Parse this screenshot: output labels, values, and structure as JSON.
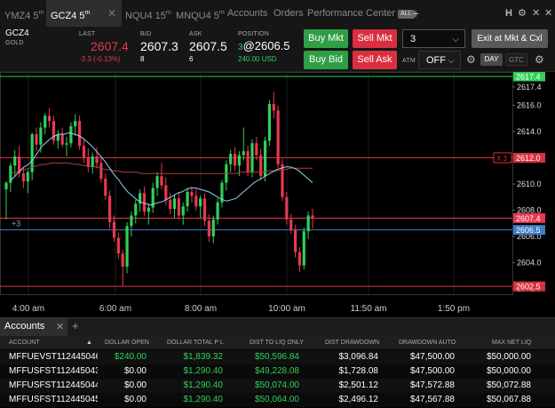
{
  "tabs": [
    {
      "symbol": "YMZ4",
      "interval": "5",
      "unit": "m"
    },
    {
      "symbol": "GCZ4",
      "interval": "5",
      "unit": "m"
    },
    {
      "symbol": "NQU4",
      "interval": "15",
      "unit": "m"
    },
    {
      "symbol": "MNQU4",
      "interval": "5",
      "unit": "m"
    }
  ],
  "nav": {
    "accounts": "Accounts",
    "orders": "Orders",
    "performance": "Performance Center",
    "all_badge": "ALL",
    "add": "+"
  },
  "window_icons": {
    "h": "H",
    "gear": "⚙",
    "close": "✕"
  },
  "instrument": {
    "symbol": "GCZ4",
    "name": "GOLD"
  },
  "quote": {
    "last_label": "LAST",
    "last": "2607.4",
    "change": "-3.3 (-0.13%)",
    "bid_label": "BID",
    "bid": "2607.3",
    "bid_size": "8",
    "ask_label": "ASK",
    "ask": "2607.5",
    "ask_size": "6",
    "position_label": "POSITION",
    "position_qty": "3",
    "position_price": "@2606.5",
    "pnl": "240.00 USD"
  },
  "buttons": {
    "buy_mkt": "Buy Mkt",
    "sell_mkt": "Sell Mkt",
    "buy_bid": "Buy Bid",
    "sell_ask": "Sell Ask",
    "exit": "Exit at Mkt & Cxl"
  },
  "quantity": "3",
  "atm_label": "ATM",
  "atm_value": "OFF",
  "tif": {
    "day": "DAY",
    "gtc": "GTC"
  },
  "colors": {
    "up": "#2fd158",
    "down": "#e8384f",
    "accent": "#2e9f44",
    "sell": "#d9303f",
    "sma": "#8fd3ee",
    "ema": "#b0403f"
  },
  "chart_data": {
    "type": "candlestick",
    "title": "",
    "xlabel": "",
    "ylabel": "",
    "ylim": [
      2601.6,
      2618.4
    ],
    "y_ticks": [
      "2617.4",
      "2616.0",
      "2614.0",
      "2612.0",
      "2610.0",
      "2608.0",
      "2606.0",
      "2604.0",
      "2602.0"
    ],
    "x_ticks": [
      "4:00 am",
      "6:00 am",
      "8:00 am",
      "10:00 am",
      "11:50 am",
      "1:50 pm"
    ],
    "price_lines": [
      {
        "label": "2617.4",
        "value": 2618.2,
        "color": "#2fd158"
      },
      {
        "label": "2612.0",
        "value": 2612.0,
        "color": "#d9303f",
        "tag": "X 3"
      },
      {
        "label": "2607.4",
        "value": 2607.4,
        "color": "#e8384f"
      },
      {
        "label": "2606.5",
        "value": 2606.5,
        "color": "#3b7fc4",
        "tag": "+3"
      },
      {
        "label": "2602.5",
        "value": 2602.2,
        "color": "#d9303f"
      }
    ],
    "candles": [
      [
        2609.6,
        2610.2,
        2607.3,
        2610.1
      ],
      [
        2610.1,
        2611.6,
        2609.4,
        2611.4
      ],
      [
        2611.4,
        2612.6,
        2610.6,
        2612.1
      ],
      [
        2612.1,
        2612.9,
        2610.5,
        2610.8
      ],
      [
        2610.8,
        2611.3,
        2609.7,
        2610.2
      ],
      [
        2610.2,
        2611.1,
        2609.3,
        2610.9
      ],
      [
        2610.9,
        2613.9,
        2610.3,
        2613.8
      ],
      [
        2613.8,
        2614.3,
        2612.5,
        2613.0
      ],
      [
        2613.0,
        2614.7,
        2612.4,
        2614.3
      ],
      [
        2614.3,
        2615.4,
        2613.8,
        2615.2
      ],
      [
        2615.2,
        2615.8,
        2614.3,
        2614.8
      ],
      [
        2614.8,
        2615.2,
        2613.0,
        2613.3
      ],
      [
        2613.3,
        2614.1,
        2612.7,
        2613.8
      ],
      [
        2613.8,
        2614.3,
        2612.8,
        2613.0
      ],
      [
        2613.0,
        2613.6,
        2612.1,
        2613.1
      ],
      [
        2613.1,
        2614.7,
        2612.8,
        2614.4
      ],
      [
        2614.4,
        2615.3,
        2613.7,
        2614.8
      ],
      [
        2614.8,
        2615.2,
        2612.6,
        2612.9
      ],
      [
        2612.9,
        2613.4,
        2611.6,
        2612.0
      ],
      [
        2612.0,
        2612.7,
        2610.9,
        2611.3
      ],
      [
        2611.3,
        2612.4,
        2610.8,
        2612.1
      ],
      [
        2612.1,
        2612.8,
        2611.2,
        2611.6
      ],
      [
        2611.6,
        2612.0,
        2610.1,
        2610.4
      ],
      [
        2610.4,
        2610.8,
        2608.8,
        2609.1
      ],
      [
        2609.1,
        2609.5,
        2606.6,
        2607.1
      ],
      [
        2607.1,
        2607.6,
        2605.6,
        2605.9
      ],
      [
        2605.9,
        2606.3,
        2604.3,
        2604.7
      ],
      [
        2604.7,
        2605.0,
        2602.2,
        2603.7
      ],
      [
        2603.7,
        2607.1,
        2603.2,
        2606.8
      ],
      [
        2606.8,
        2607.9,
        2606.0,
        2607.6
      ],
      [
        2607.6,
        2608.8,
        2607.0,
        2608.5
      ],
      [
        2608.5,
        2609.6,
        2607.9,
        2609.3
      ],
      [
        2609.3,
        2609.8,
        2607.6,
        2607.9
      ],
      [
        2607.9,
        2608.5,
        2606.9,
        2608.2
      ],
      [
        2608.2,
        2610.1,
        2607.8,
        2609.7
      ],
      [
        2609.7,
        2610.9,
        2609.1,
        2610.6
      ],
      [
        2610.6,
        2611.6,
        2609.6,
        2609.9
      ],
      [
        2609.9,
        2610.5,
        2608.4,
        2608.8
      ],
      [
        2608.8,
        2609.3,
        2607.7,
        2608.1
      ],
      [
        2608.1,
        2609.2,
        2607.4,
        2608.9
      ],
      [
        2608.9,
        2609.4,
        2607.3,
        2607.6
      ],
      [
        2607.6,
        2608.6,
        2606.9,
        2608.3
      ],
      [
        2608.3,
        2609.7,
        2607.9,
        2609.4
      ],
      [
        2609.4,
        2609.8,
        2608.6,
        2609.1
      ],
      [
        2609.1,
        2609.6,
        2608.0,
        2608.3
      ],
      [
        2608.3,
        2609.1,
        2607.4,
        2608.9
      ],
      [
        2608.9,
        2609.3,
        2606.8,
        2607.2
      ],
      [
        2607.2,
        2607.7,
        2605.6,
        2606.0
      ],
      [
        2606.0,
        2607.6,
        2605.5,
        2607.3
      ],
      [
        2607.3,
        2608.9,
        2606.9,
        2608.6
      ],
      [
        2608.6,
        2610.3,
        2608.2,
        2610.1
      ],
      [
        2610.1,
        2611.8,
        2609.5,
        2611.5
      ],
      [
        2611.5,
        2612.6,
        2610.9,
        2612.3
      ],
      [
        2612.3,
        2612.8,
        2611.0,
        2611.4
      ],
      [
        2611.4,
        2612.5,
        2610.6,
        2612.2
      ],
      [
        2612.2,
        2614.3,
        2611.8,
        2612.5
      ],
      [
        2612.5,
        2612.9,
        2610.6,
        2610.9
      ],
      [
        2610.9,
        2613.4,
        2610.5,
        2613.1
      ],
      [
        2613.1,
        2613.6,
        2611.8,
        2612.2
      ],
      [
        2612.2,
        2612.7,
        2610.3,
        2610.6
      ],
      [
        2610.6,
        2613.6,
        2610.2,
        2613.3
      ],
      [
        2613.3,
        2616.4,
        2612.9,
        2616.1
      ],
      [
        2616.1,
        2617.0,
        2615.0,
        2615.6
      ],
      [
        2615.6,
        2616.0,
        2611.2,
        2611.5
      ],
      [
        2611.5,
        2611.9,
        2608.7,
        2609.0
      ],
      [
        2609.0,
        2609.4,
        2606.9,
        2607.3
      ],
      [
        2607.3,
        2607.7,
        2606.2,
        2606.5
      ],
      [
        2606.5,
        2606.9,
        2604.4,
        2604.8
      ],
      [
        2604.8,
        2605.2,
        2603.3,
        2603.8
      ],
      [
        2603.8,
        2606.7,
        2603.5,
        2606.4
      ],
      [
        2606.4,
        2607.9,
        2605.8,
        2607.6
      ],
      [
        2607.6,
        2608.1,
        2606.6,
        2607.4
      ]
    ],
    "sma": [
      2610.3,
      2610.6,
      2611.0,
      2611.3,
      2611.5,
      2611.9,
      2612.4,
      2612.9,
      2613.2,
      2613.5,
      2613.7,
      2613.8,
      2613.8,
      2613.9,
      2613.8,
      2613.7,
      2613.5,
      2613.2,
      2612.9,
      2612.5,
      2612.1,
      2611.7,
      2611.2,
      2610.7,
      2610.3,
      2609.8,
      2609.4,
      2609.1,
      2608.8,
      2608.6,
      2608.5,
      2608.4,
      2608.5,
      2608.6,
      2608.7,
      2608.9,
      2609.1,
      2609.3,
      2609.4,
      2609.6,
      2609.7,
      2609.7,
      2609.6,
      2609.5,
      2609.4,
      2609.2,
      2609.0,
      2608.8,
      2608.7,
      2608.8,
      2608.9,
      2609.2,
      2609.5,
      2609.8,
      2610.1,
      2610.3,
      2610.5,
      2610.7,
      2610.9,
      2611.1,
      2611.2,
      2611.3,
      2611.3,
      2611.2,
      2611.0,
      2610.7,
      2610.4,
      2610.1
    ],
    "ema": [
      2610.8,
      2610.9,
      2611.0,
      2611.1,
      2611.2,
      2611.3,
      2611.4,
      2611.5,
      2611.5,
      2611.6,
      2611.6,
      2611.6,
      2611.6,
      2611.6,
      2611.5,
      2611.5,
      2611.4,
      2611.4,
      2611.3,
      2611.3,
      2611.2,
      2611.1,
      2611.1,
      2611.0,
      2611.0,
      2610.9,
      2610.9,
      2610.9,
      2610.9,
      2610.8,
      2610.8,
      2610.8,
      2610.8,
      2610.8,
      2610.8,
      2610.8,
      2610.8,
      2610.8,
      2610.8,
      2610.8,
      2610.8,
      2610.8,
      2610.8,
      2610.8,
      2610.8,
      2610.8,
      2610.8,
      2610.8,
      2610.8,
      2610.8,
      2610.8,
      2610.9,
      2610.9,
      2610.9,
      2610.9,
      2610.9,
      2610.9,
      2611.0,
      2611.0,
      2611.0,
      2611.1,
      2611.1,
      2611.2,
      2611.2,
      2611.2,
      2611.2,
      2611.2,
      2611.2
    ]
  },
  "accounts_panel": {
    "tab": "Accounts",
    "add": "+",
    "columns": [
      "ACCOUNT",
      "DOLLAR OPEN",
      "DOLLAR TOTAL P L",
      "DIST TO LIQ ONLY",
      "DIST DRAWDOWN",
      "DRAWDOWN AUTO",
      "MAX NET LIQ"
    ],
    "rows": [
      [
        "MFFUEVST112445046",
        "$240.00",
        "$1,839.32",
        "$50,596.84",
        "$3,096.84",
        "$47,500.00",
        "$50,000.00"
      ],
      [
        "MFFUSFST112445043",
        "$0.00",
        "$1,290.40",
        "$49,228.08",
        "$1,728.08",
        "$47,500.00",
        "$50,000.00"
      ],
      [
        "MFFUSFST112445044",
        "$0.00",
        "$1,290.40",
        "$50,074.00",
        "$2,501.12",
        "$47,572.88",
        "$50,072.88"
      ],
      [
        "MFFUSFST112445045",
        "$0.00",
        "$1,290.40",
        "$50,064.00",
        "$2,496.12",
        "$47,567.88",
        "$50,067.88"
      ]
    ],
    "row_colors": [
      [
        "#ffffff",
        "#2fd158",
        "#2fd158",
        "#2fd158",
        "#ffffff",
        "#ffffff",
        "#ffffff"
      ],
      [
        "#ffffff",
        "#ffffff",
        "#2fd158",
        "#2fd158",
        "#ffffff",
        "#ffffff",
        "#ffffff"
      ],
      [
        "#ffffff",
        "#ffffff",
        "#2fd158",
        "#2fd158",
        "#ffffff",
        "#ffffff",
        "#ffffff"
      ],
      [
        "#ffffff",
        "#ffffff",
        "#2fd158",
        "#2fd158",
        "#ffffff",
        "#ffffff",
        "#ffffff"
      ]
    ]
  }
}
